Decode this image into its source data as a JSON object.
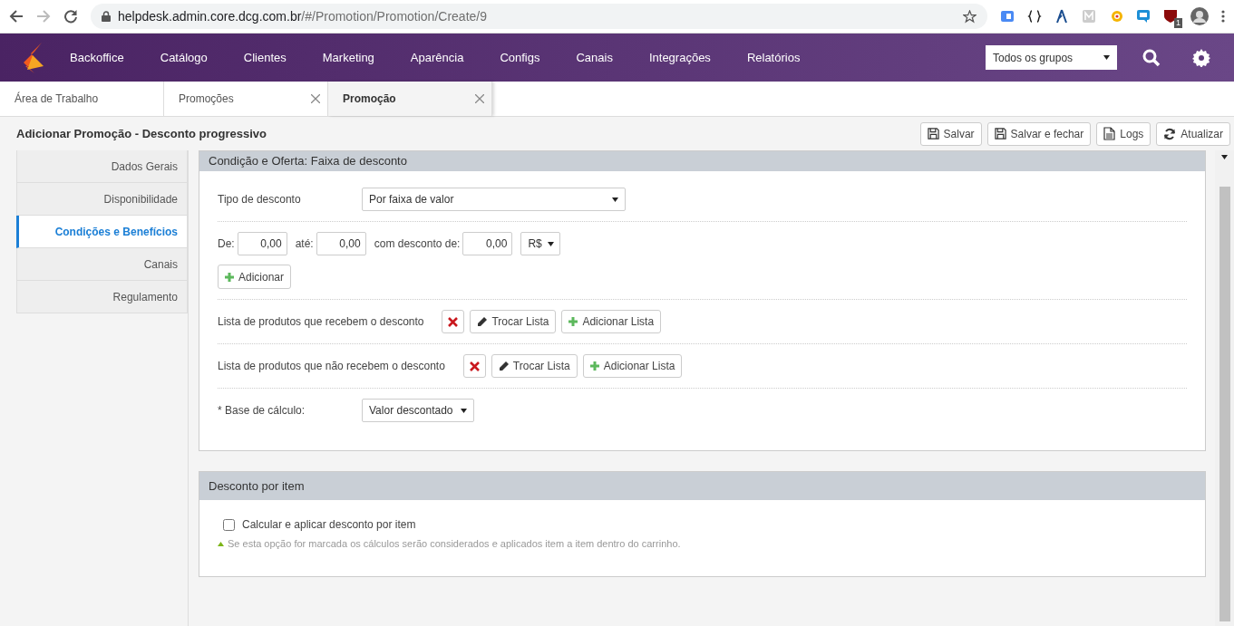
{
  "browser": {
    "url_host": "helpdesk.admin.core.dcg.com.br",
    "url_path": "/#/Promotion/Promotion/Create/9",
    "extension_badge": "1"
  },
  "nav": {
    "items": [
      "Backoffice",
      "Catálogo",
      "Clientes",
      "Marketing",
      "Aparência",
      "Configs",
      "Canais",
      "Integrações",
      "Relatórios"
    ],
    "group_select": "Todos os grupos"
  },
  "tabs": [
    {
      "label": "Área de Trabalho",
      "selected": false,
      "closable": false
    },
    {
      "label": "Promoções",
      "selected": false,
      "closable": true
    },
    {
      "label": "Promoção",
      "selected": true,
      "closable": true
    }
  ],
  "page_title": "Adicionar Promoção - Desconto progressivo",
  "actions": [
    {
      "label": "Salvar",
      "kind": "save"
    },
    {
      "label": "Salvar e fechar",
      "kind": "save"
    },
    {
      "label": "Logs",
      "kind": "doc"
    },
    {
      "label": "Atualizar",
      "kind": "refresh"
    }
  ],
  "sidebar": [
    {
      "label": "Dados Gerais",
      "selected": false
    },
    {
      "label": "Disponibilidade",
      "selected": false
    },
    {
      "label": "Condições e Benefícios",
      "selected": true
    },
    {
      "label": "Canais",
      "selected": false
    },
    {
      "label": "Regulamento",
      "selected": false
    }
  ],
  "condition_panel": {
    "title": "Condição e Oferta: Faixa de desconto",
    "discount_type_label": "Tipo de desconto",
    "discount_type_value": "Por faixa de valor",
    "range": {
      "from_label": "De:",
      "from_value": "0,00",
      "to_label": "até:",
      "to_value": "0,00",
      "discount_label": "com desconto de:",
      "discount_value": "0,00",
      "unit": "R$"
    },
    "add_button": "Adicionar",
    "lists": [
      {
        "label": "Lista de produtos que recebem o desconto",
        "change": "Trocar Lista",
        "add": "Adicionar Lista"
      },
      {
        "label": "Lista de produtos que não recebem o desconto",
        "change": "Trocar Lista",
        "add": "Adicionar Lista"
      }
    ],
    "base_label": "* Base de cálculo:",
    "base_value": "Valor descontado"
  },
  "item_panel": {
    "title": "Desconto por item",
    "checkbox_label": "Calcular e aplicar desconto por item",
    "checked": false,
    "hint": "Se esta opção for marcada os cálculos serão considerados e aplicados item a item dentro do carrinho."
  }
}
